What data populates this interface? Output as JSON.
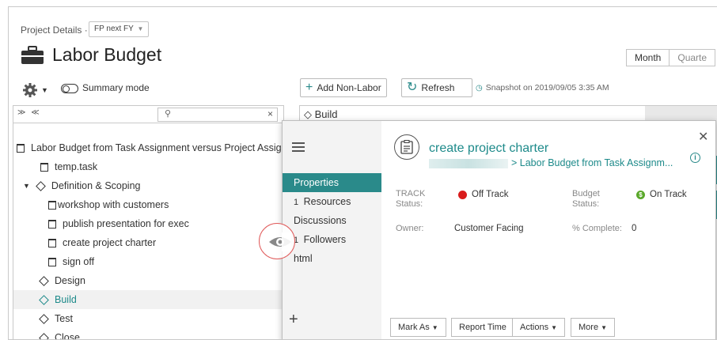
{
  "header": {
    "breadcrumb": "Project Details ·",
    "fp_select": "FP next FY",
    "title": "Labor Budget",
    "period_tabs": [
      "Month",
      "Quarte"
    ]
  },
  "left_toolbar": {
    "summary_mode": "Summary mode"
  },
  "toolbar": {
    "add_non_labor": "Add Non-Labor",
    "refresh": "Refresh",
    "snapshot": "Snapshot on 2019/09/05 3:35 AM"
  },
  "tree": {
    "expand_collapse": "≫ ≪",
    "search_placeholder": "",
    "rows": [
      {
        "label": "Labor Budget from Task Assignment versus Project Assig",
        "icon": "project-icon"
      },
      {
        "label": "temp.task",
        "icon": "task-icon"
      },
      {
        "label": "Definition & Scoping",
        "icon": "milestone-icon"
      },
      {
        "label": "workshop with customers",
        "icon": "task-icon"
      },
      {
        "label": "publish presentation for exec",
        "icon": "task-icon"
      },
      {
        "label": "create project charter",
        "icon": "task-icon"
      },
      {
        "label": "sign off",
        "icon": "task-icon"
      },
      {
        "label": "Design",
        "icon": "milestone-icon"
      },
      {
        "label": "Build",
        "icon": "milestone-icon"
      },
      {
        "label": "Test",
        "icon": "milestone-icon"
      },
      {
        "label": "Close",
        "icon": "milestone-icon"
      }
    ]
  },
  "right_panel": {
    "header": "Build"
  },
  "popup": {
    "nav": {
      "properties": "Properties",
      "resources_count": "1",
      "resources": "Resources",
      "discussions": "Discussions",
      "followers_count": "1",
      "followers": "Followers",
      "html": "html"
    },
    "title": "create project charter",
    "breadcrumb": "> Labor Budget from Task Assignm...",
    "fields": {
      "track_label": "TRACK Status:",
      "track_value": "Off Track",
      "budget_label": "Budget Status:",
      "budget_value": "On Track",
      "owner_label": "Owner:",
      "owner_value": "Customer Facing",
      "complete_label": "% Complete:",
      "complete_value": "0"
    },
    "actions": {
      "mark_as": "Mark As",
      "report_time": "Report Time",
      "actions": "Actions",
      "more": "More"
    }
  },
  "colors": {
    "accent": "#2a8a8a",
    "off_track": "#d91c1c",
    "on_track": "#5aa82a"
  }
}
